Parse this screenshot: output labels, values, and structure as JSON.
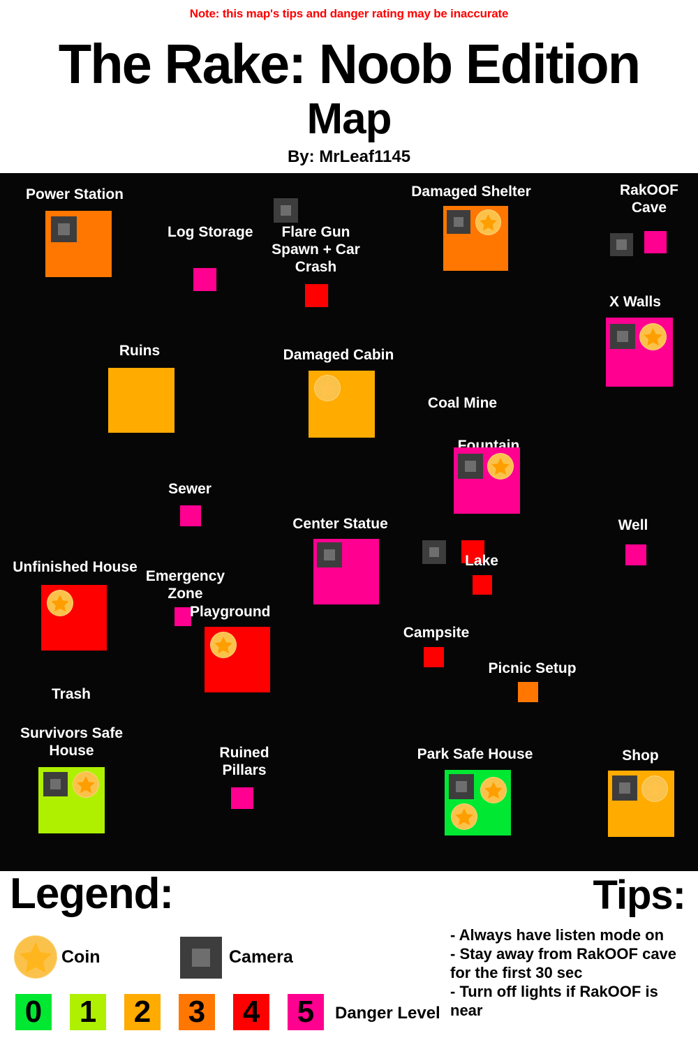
{
  "header": {
    "note": "Note: this map's tips and danger rating may be inaccurate",
    "title": "The Rake: Noob Edition",
    "subtitle": "Map",
    "byline": "By: MrLeaf1145"
  },
  "map": {
    "background": "#060606",
    "locations": [
      {
        "name": "Power Station",
        "label": "Power Station",
        "danger": 3,
        "color": "#FF7700",
        "cameras": 1,
        "coins": 0
      },
      {
        "name": "Log Storage",
        "label": "Log Storage",
        "danger": 5,
        "color": "#FF0090",
        "cameras": 0,
        "coins": 0
      },
      {
        "name": "Flare Gun Spawn + Car Crash",
        "label": "Flare Gun\nSpawn + Car\nCrash",
        "danger": 4,
        "color": "#FF0000",
        "cameras": 1,
        "coins": 0
      },
      {
        "name": "Damaged Shelter",
        "label": "Damaged Shelter",
        "danger": 3,
        "color": "#FF7700",
        "cameras": 1,
        "coins": 1
      },
      {
        "name": "RakOOF Cave",
        "label": "RakOOF\nCave",
        "danger": 5,
        "color": "#FF0090",
        "cameras": 1,
        "coins": 0
      },
      {
        "name": "X Walls",
        "label": "X Walls",
        "danger": 5,
        "color": "#FF0090",
        "cameras": 1,
        "coins": 1
      },
      {
        "name": "Ruins",
        "label": "Ruins",
        "danger": 2,
        "color": "#FFAB00",
        "cameras": 0,
        "coins": 0
      },
      {
        "name": "Damaged Cabin",
        "label": "Damaged Cabin",
        "danger": 2,
        "color": "#FFAB00",
        "cameras": 0,
        "coins": 1
      },
      {
        "name": "Coal Mine",
        "label": "Coal Mine",
        "danger": 4,
        "color": "#FF0000",
        "cameras": 1,
        "coins": 0
      },
      {
        "name": "Sewer",
        "label": "Sewer",
        "danger": 5,
        "color": "#FF0090",
        "cameras": 0,
        "coins": 0
      },
      {
        "name": "Fountain",
        "label": "Fountain",
        "danger": 5,
        "color": "#FF0090",
        "cameras": 1,
        "coins": 1
      },
      {
        "name": "Well",
        "label": "Well",
        "danger": 5,
        "color": "#FF0090",
        "cameras": 0,
        "coins": 0
      },
      {
        "name": "Center Statue",
        "label": "Center Statue",
        "danger": 5,
        "color": "#FF0090",
        "cameras": 1,
        "coins": 0
      },
      {
        "name": "Lake",
        "label": "Lake",
        "danger": 4,
        "color": "#FF0000",
        "cameras": 0,
        "coins": 0
      },
      {
        "name": "Unfinished House",
        "label": "Unfinished House",
        "danger": 4,
        "color": "#FF0000",
        "cameras": 0,
        "coins": 1
      },
      {
        "name": "Emergency Zone",
        "label": "Emergency\nZone",
        "danger": 5,
        "color": "#FF0090",
        "cameras": 0,
        "coins": 0
      },
      {
        "name": "Playground",
        "label": "Playground",
        "danger": 4,
        "color": "#FF0000",
        "cameras": 0,
        "coins": 1
      },
      {
        "name": "Campsite",
        "label": "Campsite",
        "danger": 4,
        "color": "#FF0000",
        "cameras": 0,
        "coins": 0
      },
      {
        "name": "Picnic Setup",
        "label": "Picnic Setup",
        "danger": 3,
        "color": "#FF7700",
        "cameras": 0,
        "coins": 0
      },
      {
        "name": "Trash",
        "label": "Trash",
        "danger": null,
        "color": null,
        "cameras": 0,
        "coins": 0
      },
      {
        "name": "Survivors Safe House",
        "label": "Survivors Safe\nHouse",
        "danger": 1,
        "color": "#AEF000",
        "cameras": 1,
        "coins": 1
      },
      {
        "name": "Ruined Pillars",
        "label": "Ruined\nPillars",
        "danger": 5,
        "color": "#FF0090",
        "cameras": 0,
        "coins": 0
      },
      {
        "name": "Park Safe House",
        "label": "Park Safe House",
        "danger": 0,
        "color": "#00E832",
        "cameras": 1,
        "coins": 2
      },
      {
        "name": "Shop",
        "label": "Shop",
        "danger": 2,
        "color": "#FFAB00",
        "cameras": 1,
        "coins": 1
      }
    ]
  },
  "legend": {
    "title": "Legend:",
    "coin_label": "Coin",
    "camera_label": "Camera",
    "danger_label": "Danger Level",
    "danger_levels": [
      {
        "value": "0",
        "color": "#00E832"
      },
      {
        "value": "1",
        "color": "#AEF000"
      },
      {
        "value": "2",
        "color": "#FFAB00"
      },
      {
        "value": "3",
        "color": "#FF7700"
      },
      {
        "value": "4",
        "color": "#FF0000"
      },
      {
        "value": "5",
        "color": "#FF0090"
      }
    ]
  },
  "tips": {
    "title": "Tips:",
    "items": [
      "- Always have listen mode on",
      "- Stay away from RakOOF cave for the first 30 sec",
      "- Turn off lights if RakOOF is near"
    ]
  }
}
